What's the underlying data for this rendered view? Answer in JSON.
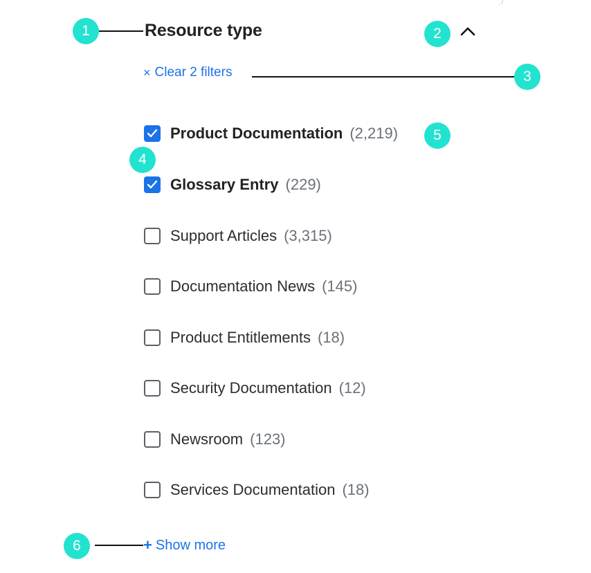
{
  "callouts": [
    "1",
    "2",
    "3",
    "4",
    "5",
    "6"
  ],
  "filter": {
    "title": "Resource type",
    "clear_label": "Clear 2 filters",
    "clear_icon": "×",
    "show_more_icon": "+",
    "show_more_label": "Show more",
    "items": [
      {
        "label": "Product Documentation",
        "count": "(2,219)",
        "checked": true
      },
      {
        "label": "Glossary Entry",
        "count": "(229)",
        "checked": true
      },
      {
        "label": "Support Articles",
        "count": "(3,315)",
        "checked": false
      },
      {
        "label": "Documentation News",
        "count": "(145)",
        "checked": false
      },
      {
        "label": "Product Entitlements",
        "count": "(18)",
        "checked": false
      },
      {
        "label": "Security Documentation",
        "count": "(12)",
        "checked": false
      },
      {
        "label": "Newsroom",
        "count": "(123)",
        "checked": false
      },
      {
        "label": "Services Documentation",
        "count": "(18)",
        "checked": false
      }
    ]
  },
  "colors": {
    "accent": "#1a73e8",
    "callout": "#22e3cf"
  }
}
